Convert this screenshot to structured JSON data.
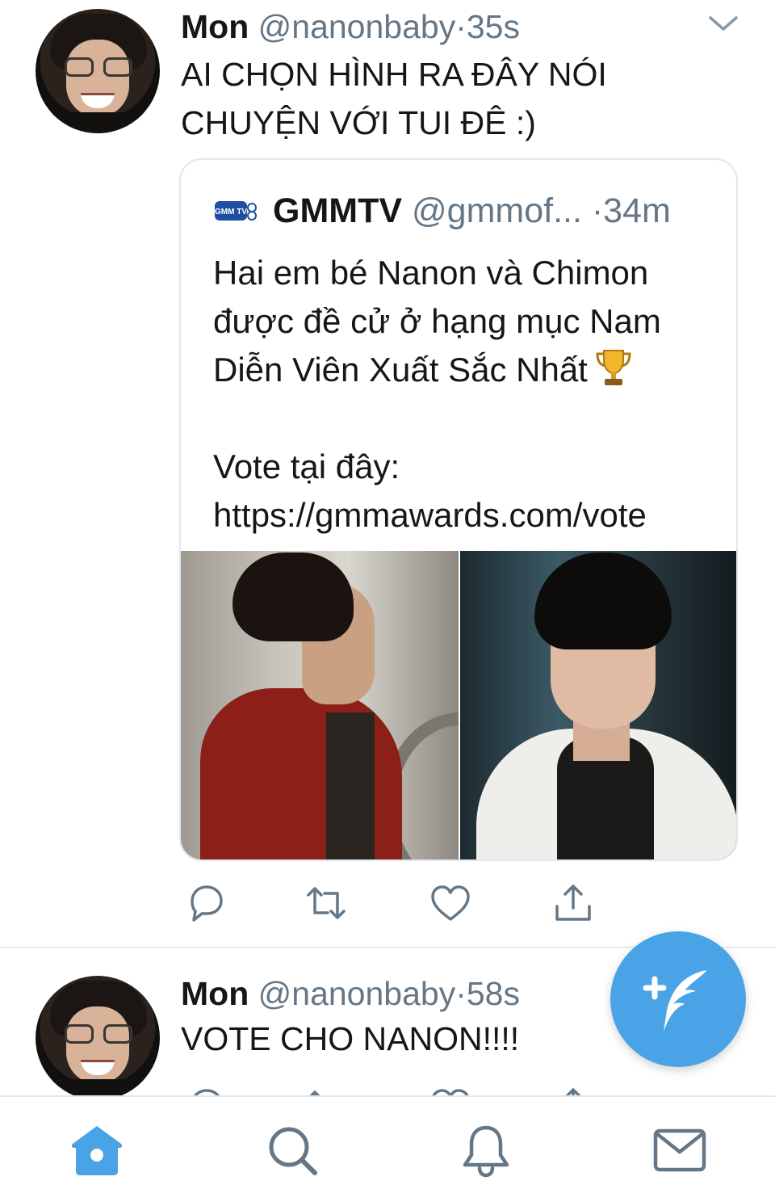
{
  "colors": {
    "accent": "#4aa3e6",
    "text_primary": "#14171a",
    "text_secondary": "#657786",
    "icon_gray": "#657786",
    "divider": "#e1e8ed"
  },
  "tweets": [
    {
      "name": "Mon",
      "handle": "@nanonbaby",
      "separator": "·",
      "time": "35s",
      "text": "AI CHỌN HÌNH RA ĐÂY NÓI CHUYỆN VỚI TUI ĐÊ :)",
      "avatar_icon": "avatar-photo",
      "quoted": {
        "logo_icon": "gmmtv-logo-icon",
        "logo_text": "GMM TV",
        "name": "GMMTV",
        "handle": "@gmmof...",
        "time": "·34m",
        "text": "Hai em bé Nanon và Chimon được đề cử ở hạng mục Nam Diễn Viên Xuất Sắc Nhất",
        "emoji": "trophy-icon",
        "vote_label": "Vote tại đây:",
        "link": "https://gmmawards.com/vote",
        "photos": [
          "photo-red-jacket",
          "photo-white-jacket"
        ]
      },
      "actions": [
        "reply-icon",
        "retweet-icon",
        "like-icon",
        "share-icon"
      ]
    },
    {
      "name": "Mon",
      "handle": "@nanonbaby",
      "separator": "·",
      "time": "58s",
      "text": "VOTE CHO NANON!!!!",
      "avatar_icon": "avatar-photo",
      "actions": [
        "reply-icon",
        "retweet-icon",
        "like-icon",
        "share-icon"
      ]
    }
  ],
  "fab": {
    "icon": "compose-tweet-icon"
  },
  "tabbar": {
    "items": [
      "home-icon",
      "search-icon",
      "notifications-icon",
      "messages-icon"
    ],
    "active": "home-icon"
  }
}
